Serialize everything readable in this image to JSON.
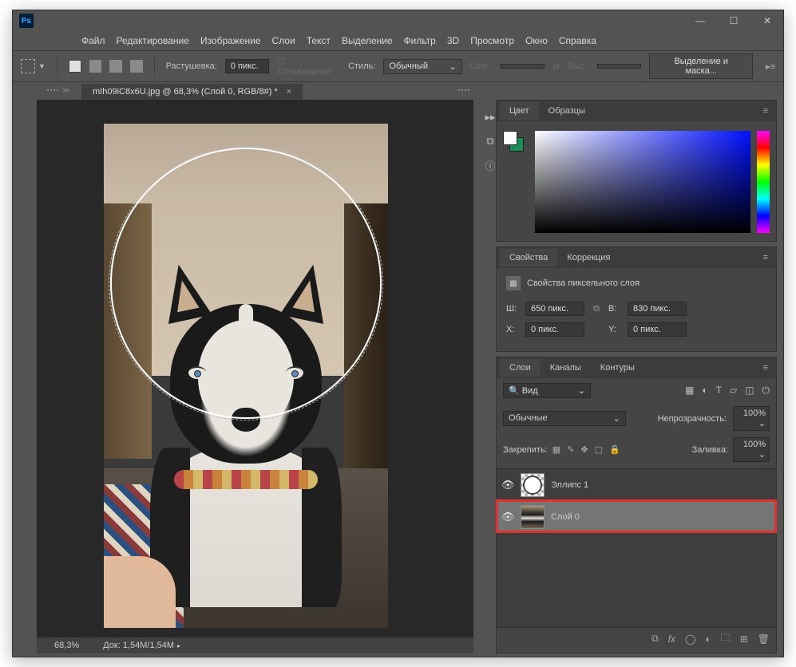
{
  "app": {
    "logo": "Ps"
  },
  "menu": [
    "Файл",
    "Редактирование",
    "Изображение",
    "Слои",
    "Текст",
    "Выделение",
    "Фильтр",
    "3D",
    "Просмотр",
    "Окно",
    "Справка"
  ],
  "options": {
    "feather_label": "Растушевка:",
    "feather_value": "0 пикс.",
    "antialias": "Сглаживание",
    "style_label": "Стиль:",
    "style_value": "Обычный",
    "width_label": "Шир.:",
    "height_label": "Выс.:",
    "mask_btn": "Выделение и маска..."
  },
  "document": {
    "tab": "mIh09iC8x6U.jpg @ 68,3% (Слой 0, RGB/8#) *",
    "zoom": "68,3%",
    "docinfo": "Док: 1,54M/1,54M"
  },
  "panels": {
    "color": {
      "title": "Цвет",
      "swatches": "Образцы"
    },
    "properties": {
      "title": "Свойства",
      "adjust": "Коррекция",
      "pixel_layer": "Свойства пиксельного слоя",
      "w": "Ш:",
      "w_val": "650 пикс.",
      "h": "В:",
      "h_val": "830 пикс.",
      "x": "X:",
      "x_val": "0 пикс.",
      "y": "Y:",
      "y_val": "0 пикс."
    },
    "layers": {
      "title": "Слои",
      "channels": "Каналы",
      "paths": "Контуры",
      "search_prefix": "🔍",
      "search": "Вид",
      "blend": "Обычные",
      "opacity_label": "Непрозрачность:",
      "opacity": "100%",
      "lock_label": "Закрепить:",
      "lock_icons_spacer": "",
      "fill_label": "Заливка:",
      "fill": "100%",
      "items": [
        {
          "name": "Эллипс 1"
        },
        {
          "name": "Слой 0"
        }
      ]
    }
  }
}
